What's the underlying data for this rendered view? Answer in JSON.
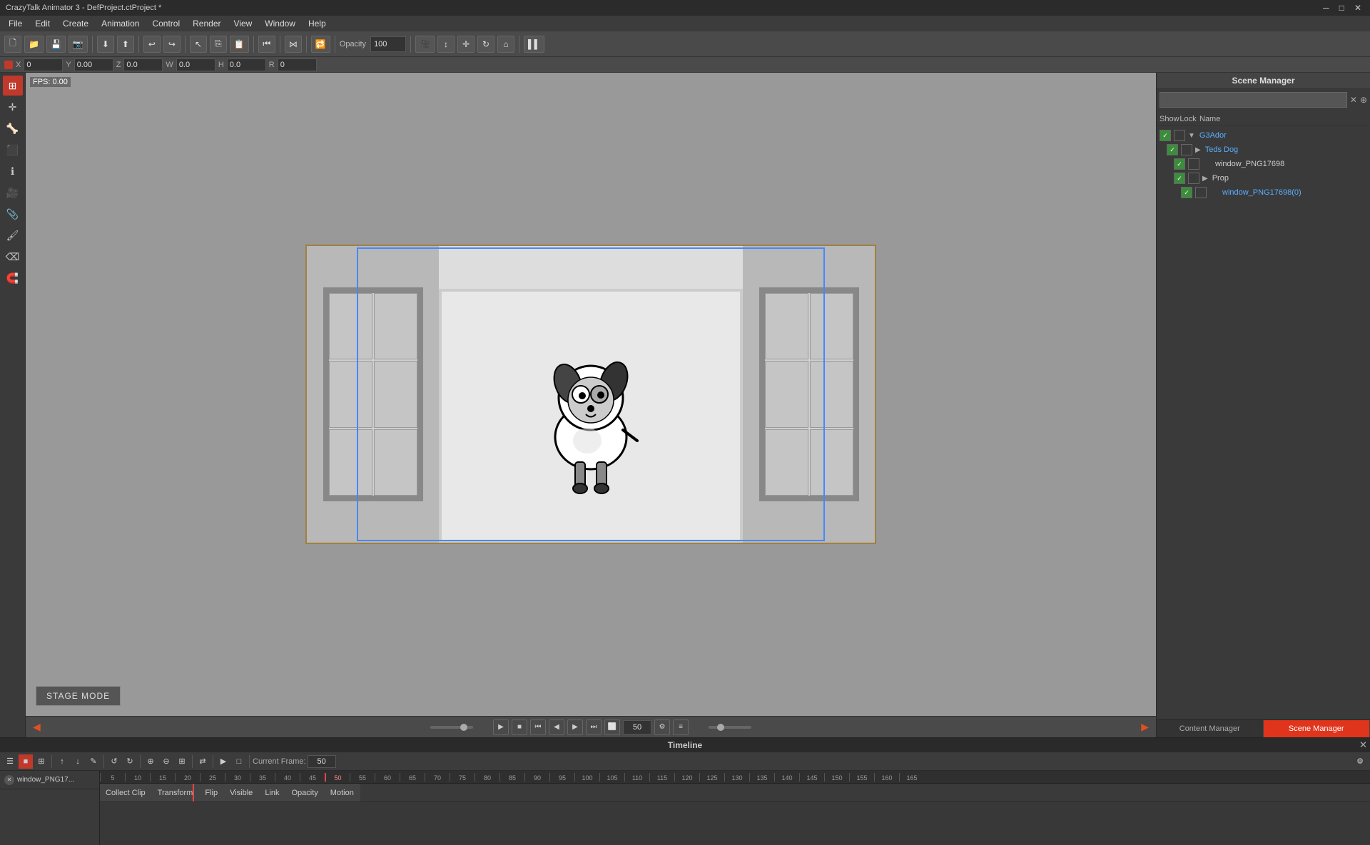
{
  "app": {
    "title": "CrazyTalk Animator 3 - DefProject.ctProject *",
    "win_controls": [
      "─",
      "□",
      "✕"
    ]
  },
  "menu": {
    "items": [
      "File",
      "Edit",
      "Create",
      "Animation",
      "Control",
      "Render",
      "View",
      "Window",
      "Help"
    ]
  },
  "toolbar": {
    "opacity_label": "Opacity",
    "opacity_value": "100"
  },
  "coords": {
    "x_label": "X",
    "x_val": "0",
    "y_label": "Y",
    "y_val": "0.00",
    "z_label": "Z",
    "z_val": "0.0",
    "w_label": "W",
    "w_val": "0.0",
    "h_label": "H",
    "h_val": "0.0",
    "r_label": "R",
    "r_val": "0"
  },
  "fps": {
    "label": "FPS: 0.00"
  },
  "stage": {
    "mode_button": "STAGE MODE"
  },
  "timeline_controls": {
    "frame_value": "50"
  },
  "scene_manager": {
    "title": "Scene Manager",
    "search_placeholder": "",
    "columns": {
      "show": "Show",
      "lock": "Lock",
      "name": "Name"
    },
    "items": [
      {
        "level": 0,
        "show": true,
        "lock": false,
        "name": "G3Ador",
        "type": "group",
        "link": false
      },
      {
        "level": 1,
        "show": true,
        "lock": false,
        "name": "Teds Dog",
        "type": "group",
        "link": true
      },
      {
        "level": 2,
        "show": true,
        "lock": false,
        "name": "window_PNG17698",
        "type": "item",
        "link": false
      },
      {
        "level": 2,
        "show": true,
        "lock": false,
        "name": "Prop",
        "type": "group",
        "link": false
      },
      {
        "level": 3,
        "show": true,
        "lock": false,
        "name": "window_PNG17698(0)",
        "type": "item",
        "link": true
      }
    ]
  },
  "panel_tabs": {
    "content_manager": "Content Manager",
    "scene_manager": "Scene Manager"
  },
  "timeline": {
    "title": "Timeline",
    "toolbar_buttons": [
      "☰",
      "■",
      "≡",
      "↑",
      "↓",
      "✎",
      "↺",
      "↻",
      "⊕",
      "⊖",
      "⊞",
      "⇄",
      "▶",
      "□"
    ],
    "current_frame_label": "Current Frame:",
    "current_frame_value": "50",
    "ruler_marks": [
      "5",
      "10",
      "15",
      "20",
      "25",
      "30",
      "35",
      "40",
      "45",
      "50",
      "55",
      "60",
      "65",
      "70",
      "75",
      "80",
      "85",
      "90",
      "95",
      "100",
      "105",
      "110",
      "115",
      "120",
      "125",
      "130",
      "135",
      "140",
      "145",
      "150",
      "155",
      "160",
      "165"
    ],
    "track_name": "window_PNG17...",
    "clip_buttons": [
      "Collect Clip",
      "Transform",
      "Flip",
      "Visible",
      "Link",
      "Opacity",
      "Motion"
    ]
  }
}
